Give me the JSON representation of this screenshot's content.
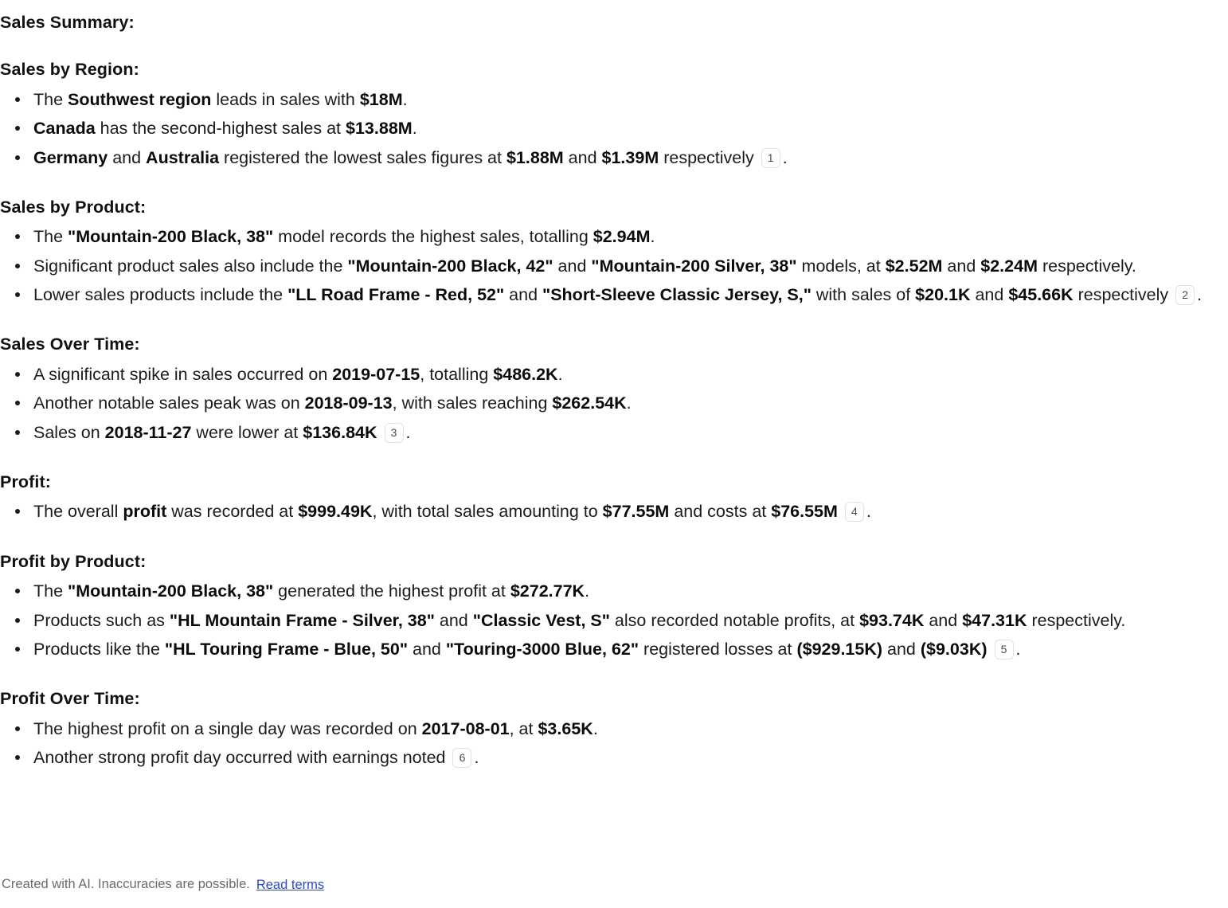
{
  "document": {
    "title": "Sales Summary:",
    "sections": [
      {
        "id": "sales-by-region",
        "heading": "Sales by Region:",
        "bullets": [
          {
            "parts": [
              {
                "t": "The ",
                "b": false
              },
              {
                "t": "Southwest region",
                "b": true
              },
              {
                "t": " leads in sales with ",
                "b": false
              },
              {
                "t": "$18M",
                "b": true
              },
              {
                "t": ".",
                "b": false
              }
            ]
          },
          {
            "parts": [
              {
                "t": "Canada",
                "b": true
              },
              {
                "t": " has the second-highest sales at ",
                "b": false
              },
              {
                "t": "$13.88M",
                "b": true
              },
              {
                "t": ".",
                "b": false
              }
            ]
          },
          {
            "parts": [
              {
                "t": "Germany",
                "b": true
              },
              {
                "t": " and ",
                "b": false
              },
              {
                "t": "Australia",
                "b": true
              },
              {
                "t": " registered the lowest sales figures at ",
                "b": false
              },
              {
                "t": "$1.88M",
                "b": true
              },
              {
                "t": " and ",
                "b": false
              },
              {
                "t": "$1.39M",
                "b": true
              },
              {
                "t": " respectively ",
                "b": false
              },
              {
                "cite": "1"
              },
              {
                "t": ".",
                "b": false
              }
            ]
          }
        ]
      },
      {
        "id": "sales-by-product",
        "heading": "Sales by Product:",
        "bullets": [
          {
            "parts": [
              {
                "t": "The ",
                "b": false
              },
              {
                "t": "\"Mountain-200 Black, 38\"",
                "b": true
              },
              {
                "t": " model records the highest sales, totalling ",
                "b": false
              },
              {
                "t": "$2.94M",
                "b": true
              },
              {
                "t": ".",
                "b": false
              }
            ]
          },
          {
            "parts": [
              {
                "t": "Significant product sales also include the ",
                "b": false
              },
              {
                "t": "\"Mountain-200 Black, 42\"",
                "b": true
              },
              {
                "t": " and ",
                "b": false
              },
              {
                "t": "\"Mountain-200 Silver, 38\"",
                "b": true
              },
              {
                "t": " models, at ",
                "b": false
              },
              {
                "t": "$2.52M",
                "b": true
              },
              {
                "t": " and ",
                "b": false
              },
              {
                "t": "$2.24M",
                "b": true
              },
              {
                "t": " respectively.",
                "b": false
              }
            ]
          },
          {
            "parts": [
              {
                "t": "Lower sales products include the ",
                "b": false
              },
              {
                "t": "\"LL Road Frame - Red, 52\"",
                "b": true
              },
              {
                "t": " and ",
                "b": false
              },
              {
                "t": "\"Short-Sleeve Classic Jersey, S,\"",
                "b": true
              },
              {
                "t": " with sales of ",
                "b": false
              },
              {
                "t": "$20.1K",
                "b": true
              },
              {
                "t": " and ",
                "b": false
              },
              {
                "t": "$45.66K",
                "b": true
              },
              {
                "t": " respectively ",
                "b": false
              },
              {
                "cite": "2"
              },
              {
                "t": ".",
                "b": false
              }
            ]
          }
        ]
      },
      {
        "id": "sales-over-time",
        "heading": "Sales Over Time:",
        "bullets": [
          {
            "parts": [
              {
                "t": "A significant spike in sales occurred on ",
                "b": false
              },
              {
                "t": "2019-07-15",
                "b": true
              },
              {
                "t": ", totalling ",
                "b": false
              },
              {
                "t": "$486.2K",
                "b": true
              },
              {
                "t": ".",
                "b": false
              }
            ]
          },
          {
            "parts": [
              {
                "t": "Another notable sales peak was on ",
                "b": false
              },
              {
                "t": "2018-09-13",
                "b": true
              },
              {
                "t": ", with sales reaching ",
                "b": false
              },
              {
                "t": "$262.54K",
                "b": true
              },
              {
                "t": ".",
                "b": false
              }
            ]
          },
          {
            "parts": [
              {
                "t": "Sales on ",
                "b": false
              },
              {
                "t": "2018-11-27",
                "b": true
              },
              {
                "t": " were lower at ",
                "b": false
              },
              {
                "t": "$136.84K",
                "b": true
              },
              {
                "t": " ",
                "b": false
              },
              {
                "cite": "3"
              },
              {
                "t": ".",
                "b": false
              }
            ]
          }
        ]
      },
      {
        "id": "profit",
        "heading": "Profit:",
        "bullets": [
          {
            "parts": [
              {
                "t": "The overall ",
                "b": false
              },
              {
                "t": "profit",
                "b": true
              },
              {
                "t": " was recorded at ",
                "b": false
              },
              {
                "t": "$999.49K",
                "b": true
              },
              {
                "t": ", with total sales amounting to ",
                "b": false
              },
              {
                "t": "$77.55M",
                "b": true
              },
              {
                "t": " and costs at ",
                "b": false
              },
              {
                "t": "$76.55M",
                "b": true
              },
              {
                "t": " ",
                "b": false
              },
              {
                "cite": "4"
              },
              {
                "t": ".",
                "b": false
              }
            ]
          }
        ]
      },
      {
        "id": "profit-by-product",
        "heading": "Profit by Product:",
        "bullets": [
          {
            "parts": [
              {
                "t": "The ",
                "b": false
              },
              {
                "t": "\"Mountain-200 Black, 38\"",
                "b": true
              },
              {
                "t": " generated the highest profit at ",
                "b": false
              },
              {
                "t": "$272.77K",
                "b": true
              },
              {
                "t": ".",
                "b": false
              }
            ]
          },
          {
            "parts": [
              {
                "t": "Products such as ",
                "b": false
              },
              {
                "t": "\"HL Mountain Frame - Silver, 38\"",
                "b": true
              },
              {
                "t": " and ",
                "b": false
              },
              {
                "t": "\"Classic Vest, S\"",
                "b": true
              },
              {
                "t": " also recorded notable profits, at ",
                "b": false
              },
              {
                "t": "$93.74K",
                "b": true
              },
              {
                "t": " and ",
                "b": false
              },
              {
                "t": "$47.31K",
                "b": true
              },
              {
                "t": " respectively.",
                "b": false
              }
            ]
          },
          {
            "parts": [
              {
                "t": "Products like the ",
                "b": false
              },
              {
                "t": "\"HL Touring Frame - Blue, 50\"",
                "b": true
              },
              {
                "t": " and ",
                "b": false
              },
              {
                "t": "\"Touring-3000 Blue, 62\"",
                "b": true
              },
              {
                "t": " registered losses at ",
                "b": false
              },
              {
                "t": "($929.15K)",
                "b": true
              },
              {
                "t": " and ",
                "b": false
              },
              {
                "t": "($9.03K)",
                "b": true
              },
              {
                "t": " ",
                "b": false
              },
              {
                "cite": "5"
              },
              {
                "t": ".",
                "b": false
              }
            ]
          }
        ]
      },
      {
        "id": "profit-over-time",
        "heading": "Profit Over Time:",
        "bullets": [
          {
            "parts": [
              {
                "t": "The highest profit on a single day was recorded on ",
                "b": false
              },
              {
                "t": "2017-08-01",
                "b": true
              },
              {
                "t": ", at ",
                "b": false
              },
              {
                "t": "$3.65K",
                "b": true
              },
              {
                "t": ".",
                "b": false
              }
            ]
          },
          {
            "parts": [
              {
                "t": "Another strong profit day occurred with earnings noted ",
                "b": false
              },
              {
                "cite": "6"
              },
              {
                "t": ".",
                "b": false
              }
            ]
          }
        ]
      }
    ]
  },
  "footer": {
    "disclaimer": "Created with AI. Inaccuracies are possible.",
    "terms_label": "Read terms"
  },
  "colors": {
    "text": "#1b1b1b",
    "heading": "#111111",
    "link": "#2b4acb",
    "muted": "#6b6b6b",
    "citation_border": "#e2e2e2"
  }
}
